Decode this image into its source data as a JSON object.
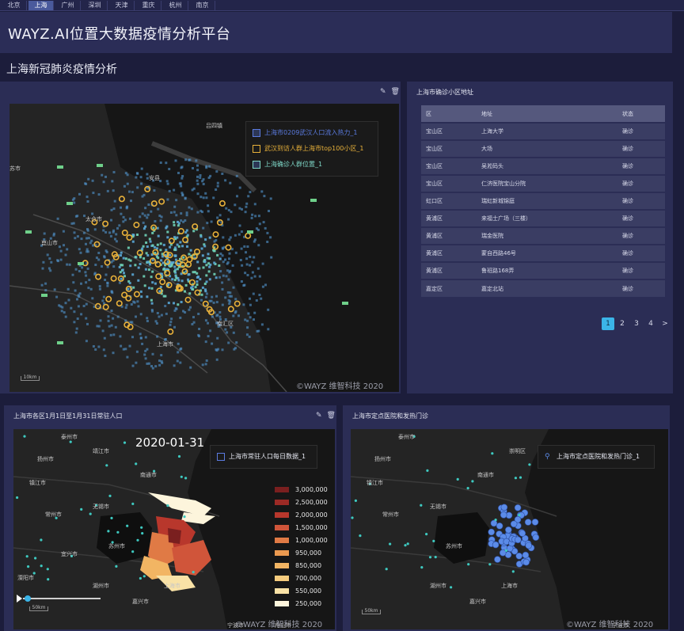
{
  "tabs": [
    {
      "label": "北京",
      "active": false
    },
    {
      "label": "上海",
      "active": true
    },
    {
      "label": "广州",
      "active": false
    },
    {
      "label": "深圳",
      "active": false
    },
    {
      "label": "天津",
      "active": false
    },
    {
      "label": "重庆",
      "active": false
    },
    {
      "label": "杭州",
      "active": false
    },
    {
      "label": "南京",
      "active": false
    }
  ],
  "header": {
    "title": "WAYZ.AI位置大数据疫情分析平台"
  },
  "subtitle": "上海新冠肺炎疫情分析",
  "main_map": {
    "layers": [
      {
        "label": "上海市0209武汉人口流入热力_1",
        "color": "#5b7be0"
      },
      {
        "label": "武汉到访人群上海市top100小区_1",
        "color": "#e8b13a"
      },
      {
        "label": "上海确诊人群位置_1",
        "color": "#7fd8c8"
      }
    ],
    "place_labels": [
      "吕四镇",
      "苏市",
      "安县",
      "太仓市",
      "崑山市",
      "上海市",
      "南汇区"
    ],
    "scale": "10km",
    "copyright": "©WAYZ 维智科技 2020"
  },
  "cases_panel": {
    "title": "上海市确诊小区地址",
    "columns": [
      "区",
      "地址",
      "状态"
    ],
    "rows": [
      [
        "宝山区",
        "上海大学",
        "确诊"
      ],
      [
        "宝山区",
        "大场",
        "确诊"
      ],
      [
        "宝山区",
        "吴淞码头",
        "确诊"
      ],
      [
        "宝山区",
        "仁济医院宝山分院",
        "确诊"
      ],
      [
        "虹口区",
        "瑞虹新城锦庭",
        "确诊"
      ],
      [
        "黄浦区",
        "来福士广场（三楼）",
        "确诊"
      ],
      [
        "黄浦区",
        "瑞金医院",
        "确诊"
      ],
      [
        "黄浦区",
        "蒙自西路46号",
        "确诊"
      ],
      [
        "黄浦区",
        "鲁班路168弄",
        "确诊"
      ],
      [
        "嘉定区",
        "嘉定北站",
        "确诊"
      ]
    ],
    "pages": [
      "1",
      "2",
      "3",
      "4"
    ],
    "current_page": "1",
    "next_label": ">"
  },
  "resident_panel": {
    "title": "上海市各区1月1日至1月31日常驻人口",
    "date": "2020-01-31",
    "layer_label": "上海市常驻人口每日数据_1",
    "legend": [
      {
        "label": "3,000,000",
        "color": "#7a1f1f"
      },
      {
        "label": "2,500,000",
        "color": "#9c2a25"
      },
      {
        "label": "2,000,000",
        "color": "#b8372c"
      },
      {
        "label": "1,500,000",
        "color": "#d0553a"
      },
      {
        "label": "1,000,000",
        "color": "#e07a45"
      },
      {
        "label": "950,000",
        "color": "#ec9a50"
      },
      {
        "label": "850,000",
        "color": "#f2b563"
      },
      {
        "label": "700,000",
        "color": "#f6cc7e"
      },
      {
        "label": "550,000",
        "color": "#f9e2a6"
      },
      {
        "label": "250,000",
        "color": "#fdf5dc"
      }
    ],
    "place_labels": [
      "泰州市",
      "扬州市",
      "镇江市",
      "常州市",
      "无锡市",
      "苏州市",
      "南通市",
      "上海市",
      "湖州市",
      "嘉兴市",
      "宁波市",
      "舟山市",
      "溧阳市",
      "宜兴市",
      "靖江市"
    ],
    "scale": "50km",
    "copyright": "©WAYZ 维智科技 2020"
  },
  "hospital_panel": {
    "title": "上海市定点医院和发热门诊",
    "layer_label": "上海市定点医院和发热门诊_1",
    "place_labels": [
      "泰州市",
      "扬州市",
      "镇江市",
      "常州市",
      "无锡市",
      "苏州市",
      "南通市",
      "上海市",
      "湖州市",
      "嘉兴市",
      "宁波市",
      "崇明区"
    ],
    "scale": "50km",
    "copyright": "©WAYZ 维智科技 2020"
  },
  "colors": {
    "accent": "#3bb5e8",
    "bg": "#1c1d3b",
    "panel": "#2b2d55",
    "marker": "#e8b13a",
    "hospital": "#5b8be8"
  }
}
